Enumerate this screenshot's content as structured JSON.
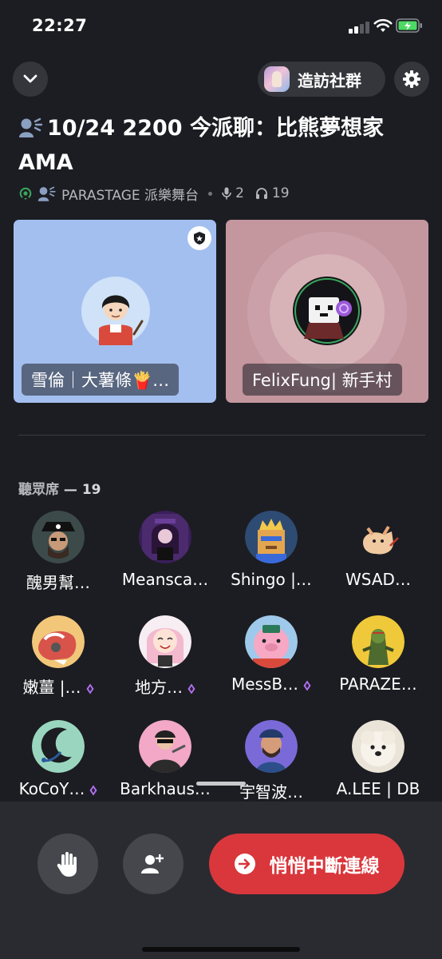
{
  "status_bar": {
    "time": "22:27"
  },
  "header": {
    "visit_label": "造訪社群"
  },
  "stage": {
    "title_line1": "10/24 2200 今派聊：比熊夢想家",
    "title_line2": "AMA",
    "channel": "PARASTAGE 派樂舞台",
    "speaker_count": "2",
    "listener_count": "19"
  },
  "speakers": [
    {
      "name": "雪倫｜大薯條🍟…",
      "color": "#a3bff0"
    },
    {
      "name": "FelixFung| 新手村",
      "color": "#c4969e"
    }
  ],
  "audience": {
    "label": "聽眾席",
    "count": "— 19",
    "members": [
      {
        "name": "醜男幫…",
        "gem": false
      },
      {
        "name": "Meansca…",
        "gem": false
      },
      {
        "name": "Shingo |…",
        "gem": false
      },
      {
        "name": "WSAD…",
        "gem": false
      },
      {
        "name": "嫩薑 |…",
        "gem": true
      },
      {
        "name": "地方…",
        "gem": true
      },
      {
        "name": "MessB…",
        "gem": true
      },
      {
        "name": "PARAZE…",
        "gem": false
      },
      {
        "name": "KoCoY…",
        "gem": true
      },
      {
        "name": "Barkhaus…",
        "gem": false
      },
      {
        "name": "宇智波…",
        "gem": false
      },
      {
        "name": "A.LEE | DB",
        "gem": false
      }
    ]
  },
  "controls": {
    "leave_label": "悄悄中斷連線"
  },
  "colors": {
    "leave": "#d9373c",
    "nitro_gem": "#b673f5",
    "background": "#1c1d22"
  },
  "icons": [
    "chevron-down-icon",
    "gear-icon",
    "speaker-icon",
    "stage-icon",
    "mic-icon",
    "headphones-icon",
    "moderator-badge-icon",
    "raise-hand-icon",
    "add-user-icon",
    "arrow-right-icon",
    "nitro-gem-icon"
  ]
}
